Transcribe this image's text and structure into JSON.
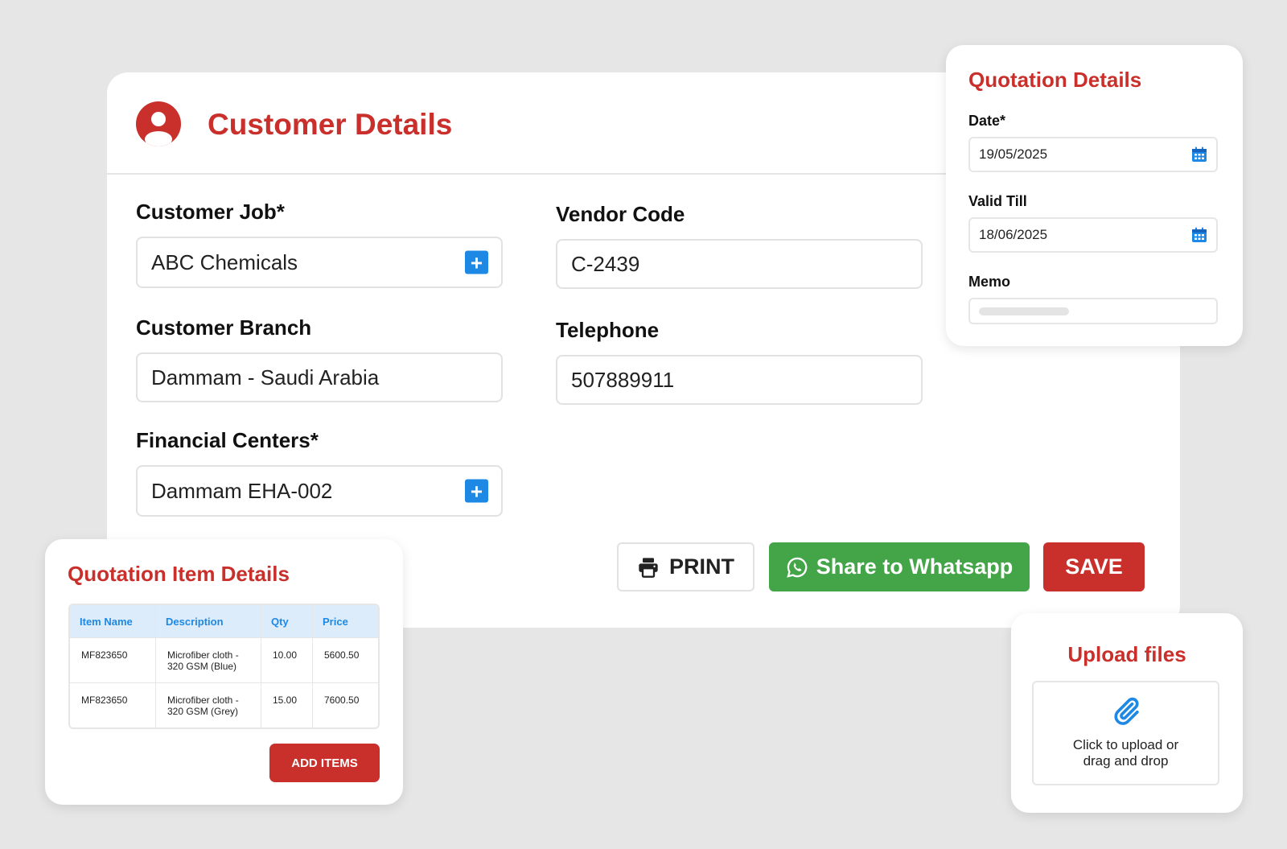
{
  "customer": {
    "title": "Customer Details",
    "customer_job": {
      "label": "Customer Job*",
      "value": "ABC Chemicals"
    },
    "vendor_code": {
      "label": "Vendor Code",
      "value": "C-2439"
    },
    "customer_branch": {
      "label": "Customer Branch",
      "value": "Dammam - Saudi Arabia"
    },
    "telephone": {
      "label": "Telephone",
      "value": "507889911"
    },
    "financial_centers": {
      "label": "Financial Centers*",
      "value": "Dammam EHA-002"
    },
    "plus_symbol": "+"
  },
  "actions": {
    "print_label": "PRINT",
    "whatsapp_label": "Share to Whatsapp",
    "save_label": "SAVE"
  },
  "quotation": {
    "title": "Quotation Details",
    "date": {
      "label": "Date*",
      "value": "19/05/2025"
    },
    "valid_till": {
      "label": "Valid Till",
      "value": "18/06/2025"
    },
    "memo": {
      "label": "Memo",
      "value": ""
    }
  },
  "items": {
    "title": "Quotation Item Details",
    "columns": [
      "Item Name",
      "Description",
      "Qty",
      "Price"
    ],
    "rows": [
      [
        "MF823650",
        "Microfiber cloth - 320 GSM (Blue)",
        "10.00",
        "5600.50"
      ],
      [
        "MF823650",
        "Microfiber cloth - 320 GSM (Grey)",
        "15.00",
        "7600.50"
      ]
    ],
    "add_label": "ADD ITEMS"
  },
  "upload": {
    "title": "Upload files",
    "text": "Click to upload or drag and drop"
  },
  "colors": {
    "brand_red": "#c9302c",
    "accent_blue": "#1e88e5",
    "whatsapp_green": "#43a548",
    "background": "#e6e6e6"
  },
  "icons": [
    "user-avatar-icon",
    "plus-icon",
    "printer-icon",
    "whatsapp-icon",
    "calendar-icon",
    "paperclip-icon"
  ]
}
